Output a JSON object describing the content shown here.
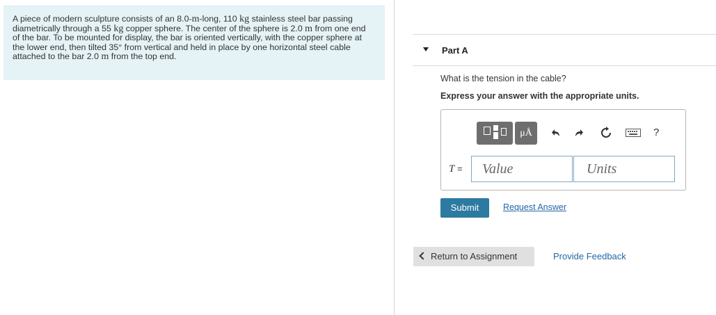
{
  "problem": {
    "segments": [
      {
        "t": "A piece of modern sculpture consists of an 8.0-"
      },
      {
        "u": "m"
      },
      {
        "t": "-long, 110 "
      },
      {
        "u": "kg"
      },
      {
        "t": " stainless steel bar passing diametrically through a 55 "
      },
      {
        "u": "kg"
      },
      {
        "t": " copper sphere. The center of the sphere is 2.0 "
      },
      {
        "u": "m"
      },
      {
        "t": " from one end of the bar. To be mounted for display, the bar is oriented vertically, with the copper sphere at the lower end, then tilted 35° from vertical and held in place by one horizontal steel cable attached to the bar 2.0 "
      },
      {
        "u": "m"
      },
      {
        "t": " from the top end."
      }
    ]
  },
  "part": {
    "title": "Part A",
    "question": "What is the tension in the cable?",
    "instruction": "Express your answer with the appropriate units."
  },
  "toolbar": {
    "units_button_label": "μÅ",
    "help_label": "?"
  },
  "answer": {
    "variable": "T",
    "equals": " =",
    "value_placeholder": "Value",
    "units_placeholder": "Units"
  },
  "actions": {
    "submit_label": "Submit",
    "request_answer_label": "Request Answer",
    "return_label": "Return to Assignment",
    "feedback_label": "Provide Feedback"
  }
}
